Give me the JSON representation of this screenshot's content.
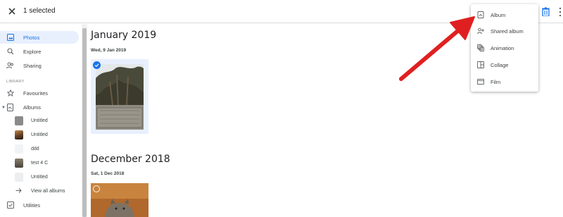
{
  "topbar": {
    "selected_text": "1 selected",
    "close_icon": "close-icon",
    "trash_icon": "trash-icon",
    "more_icon": "more-vert-icon"
  },
  "sidebar": {
    "items": [
      {
        "label": "Photos",
        "icon": "photo-icon",
        "active": true
      },
      {
        "label": "Explore",
        "icon": "search-icon"
      },
      {
        "label": "Sharing",
        "icon": "people-icon"
      }
    ],
    "library_label": "LIBRARY",
    "library_items": [
      {
        "label": "Favourites",
        "icon": "star-icon"
      },
      {
        "label": "Albums",
        "icon": "album-icon"
      }
    ],
    "albums": [
      {
        "label": "Untitled",
        "thumb_color": "#8a8a8a"
      },
      {
        "label": "Untitled",
        "thumb_color": "#7a5a3a"
      },
      {
        "label": "ddd",
        "thumb_color": "#f1f3f4"
      },
      {
        "label": "test 4 C",
        "thumb_color": "#6b6355"
      },
      {
        "label": "Untitled",
        "thumb_color": "#e8eaed"
      },
      {
        "label": "View all albums",
        "icon": "arrow-right-icon"
      }
    ],
    "utilities": {
      "label": "Utilities",
      "icon": "check-box-icon"
    }
  },
  "main": {
    "sections": [
      {
        "month": "January 2019",
        "day": "Wed, 9 Jan 2019"
      },
      {
        "month": "December 2018",
        "day": "Sat, 1 Dec 2018"
      }
    ]
  },
  "menu": {
    "items": [
      {
        "label": "Album",
        "icon": "album-icon"
      },
      {
        "label": "Shared album",
        "icon": "shared-album-icon"
      },
      {
        "label": "Animation",
        "icon": "animation-icon"
      },
      {
        "label": "Collage",
        "icon": "collage-icon"
      },
      {
        "label": "Film",
        "icon": "film-icon"
      }
    ]
  },
  "colors": {
    "accent": "#1a73e8",
    "active_bg": "#e8f0fe",
    "arrow": "#e02020"
  }
}
